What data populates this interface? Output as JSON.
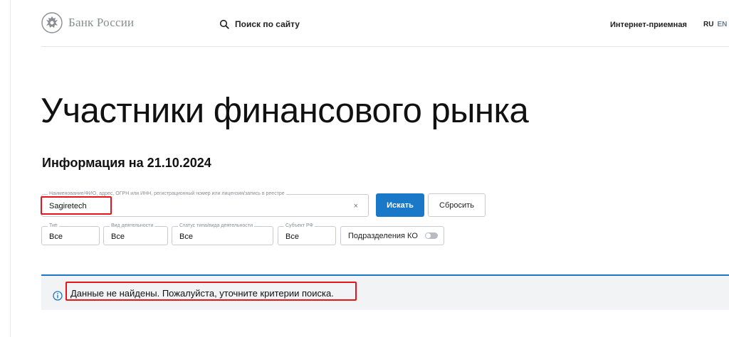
{
  "header": {
    "logo_text": "Банк России",
    "search_label": "Поиск по сайту",
    "reception_label": "Интернет-приемная",
    "lang_ru": "RU",
    "lang_en": "EN"
  },
  "page": {
    "title": "Участники финансового рынка",
    "info_date": "Информация на 21.10.2024"
  },
  "search": {
    "legend": "Наименование/ФИО, адрес, ОГРН или ИНН, регистрационный номер или лицензия/запись в реестре",
    "value": "Sagiretech",
    "clear_icon": "×",
    "search_button": "Искать",
    "reset_button": "Сбросить"
  },
  "filters": {
    "type": {
      "legend": "Тип",
      "value": "Все"
    },
    "activity": {
      "legend": "Вид деятельности",
      "value": "Все"
    },
    "status": {
      "legend": "Статус типа/вида деятельности",
      "value": "Все"
    },
    "region": {
      "legend": "Субъект РФ",
      "value": "Все"
    },
    "branches_toggle_label": "Подразделения КО",
    "branches_toggle_on": false
  },
  "notice": {
    "message": "Данные не найдены. Пожалуйста, уточните критерии поиска.",
    "icon": "info-icon"
  },
  "colors": {
    "accent": "#1a78c8",
    "highlight": "#e8141c",
    "notice_bg": "#f2f3f5"
  }
}
